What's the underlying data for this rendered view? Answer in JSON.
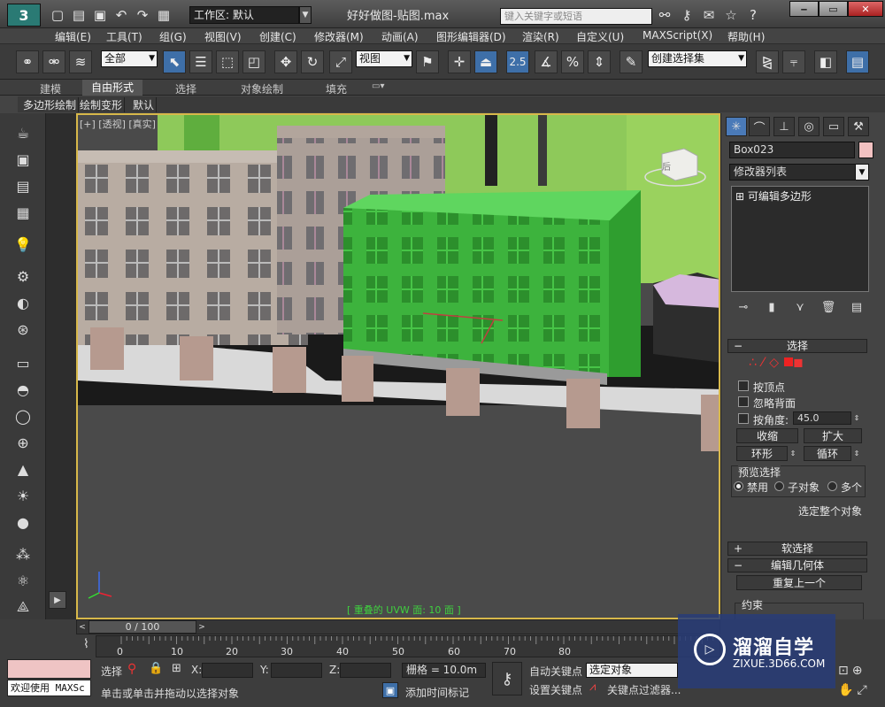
{
  "titlebar": {
    "logo": "3",
    "workspace": "工作区: 默认",
    "doc_title": "好好做图-贴图.max",
    "search_placeholder": "键入关键字或短语"
  },
  "menu": [
    "编辑(E)",
    "工具(T)",
    "组(G)",
    "视图(V)",
    "创建(C)",
    "修改器(M)",
    "动画(A)",
    "图形编辑器(D)",
    "渲染(R)",
    "自定义(U)",
    "MAXScript(X)",
    "帮助(H)"
  ],
  "toolbar": {
    "filter_dropdown": "全部",
    "coord_dropdown": "视图",
    "snap_label": "2.5",
    "named_selection": "创建选择集"
  },
  "ribbon": {
    "tabs": [
      "建模",
      "自由形式",
      "选择",
      "对象绘制",
      "填充"
    ],
    "subtabs": [
      "多边形绘制",
      "绘制变形",
      "默认"
    ]
  },
  "viewport": {
    "label": "[+] [透视] [真实]",
    "viewcube_label": "后",
    "status": "[ 重叠的 UVW 面: 10 面 ]"
  },
  "command_panel": {
    "object_name": "Box023",
    "object_color": "#f3c2c2",
    "modifier_list": "修改器列表",
    "stack_item": "可编辑多边形",
    "selection_rollout": "选择",
    "by_vertex": "按顶点",
    "ignore_backfacing": "忽略背面",
    "by_angle": "按角度:",
    "angle_value": "45.0",
    "shrink": "收缩",
    "grow": "扩大",
    "ring": "环形",
    "loop": "循环",
    "preview_selection": "预览选择",
    "disabled": "禁用",
    "sub_object": "子对象",
    "multi": "多个",
    "select_whole": "选定整个对象",
    "soft_selection": "软选择",
    "edit_geometry": "编辑几何体",
    "repeat_last": "重复上一个",
    "constraints": "约束"
  },
  "bottom": {
    "time_position": "0 / 100",
    "ticks": [
      "0",
      "10",
      "20",
      "30",
      "40",
      "50",
      "60",
      "70",
      "80"
    ],
    "maxscript_text": "欢迎使用 MAXSc",
    "select_label": "选择",
    "x_label": "X:",
    "y_label": "Y:",
    "z_label": "Z:",
    "grid": "栅格 = 10.0m",
    "auto_key": "自动关键点",
    "set_key": "设置关键点",
    "selected_object": "选定对象",
    "key_filters": "关键点过滤器...",
    "prompt": "单击或单击并拖动以选择对象",
    "add_time_tag": "添加时间标记"
  },
  "watermark": {
    "title": "溜溜自学",
    "url": "ZIXUE.3D66.COM"
  }
}
